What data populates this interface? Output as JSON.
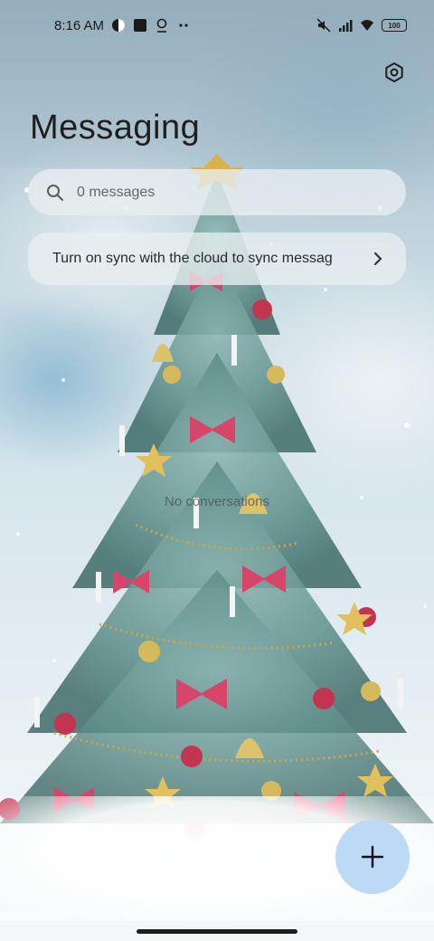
{
  "status_bar": {
    "time": "8:16 AM",
    "left_icons": [
      "vpn-key-icon",
      "app-square-icon",
      "notification-icon",
      "more-dots-icon"
    ],
    "right_icons": [
      "mute-vibrate-icon",
      "signal-icon",
      "wifi-icon",
      "battery-icon"
    ],
    "battery": "100"
  },
  "header": {
    "title": "Messaging",
    "settings_icon": "settings-gear-icon"
  },
  "search": {
    "placeholder": "0 messages",
    "icon": "search-icon"
  },
  "sync_banner": {
    "text": "Turn on sync with the cloud to sync messag",
    "chevron_icon": "chevron-right-icon"
  },
  "empty_state": {
    "text": "No conversations"
  },
  "fab": {
    "icon": "plus-icon",
    "color": "#bcd9f5"
  },
  "colors": {
    "accent": "#bcd9f5",
    "text_primary": "#1f1f1f"
  }
}
